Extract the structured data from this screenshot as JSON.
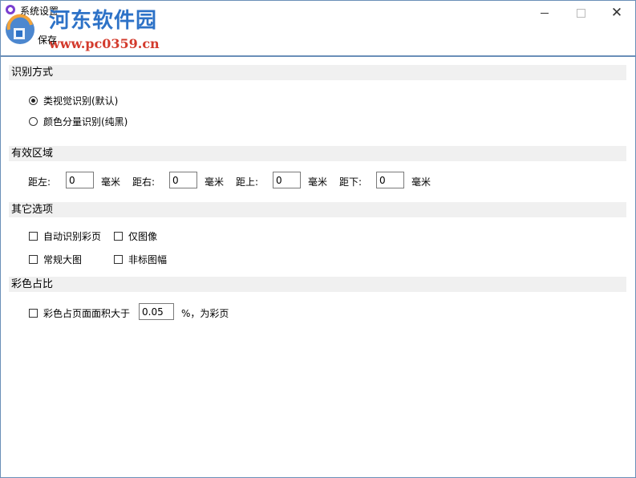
{
  "window": {
    "title": "系统设置",
    "controls": {
      "minimize": "minimize-icon",
      "maximize": "maximize-icon",
      "close": "close-icon"
    }
  },
  "watermark": {
    "site_name": "河东软件园",
    "url": "www.pc0359.cn"
  },
  "toolbar": {
    "save_label": "保存"
  },
  "recognition": {
    "header": "识别方式",
    "options": [
      {
        "label": "类视觉识别(默认)",
        "selected": true
      },
      {
        "label": "颜色分量识别(纯黑)",
        "selected": false
      }
    ]
  },
  "effective_area": {
    "header": "有效区域",
    "fields": [
      {
        "label": "距左:",
        "value": "0",
        "unit": "毫米"
      },
      {
        "label": "距右:",
        "value": "0",
        "unit": "毫米"
      },
      {
        "label": "距上:",
        "value": "0",
        "unit": "毫米"
      },
      {
        "label": "距下:",
        "value": "0",
        "unit": "毫米"
      }
    ]
  },
  "other_options": {
    "header": "其它选项",
    "checkboxes": [
      {
        "label": "自动识别彩页",
        "checked": false
      },
      {
        "label": "仅图像",
        "checked": false
      },
      {
        "label": "常规大图",
        "checked": false
      },
      {
        "label": "非标图幅",
        "checked": false
      }
    ]
  },
  "color_ratio": {
    "header": "彩色占比",
    "checkbox_label": "彩色占页面面积大于",
    "checked": false,
    "value": "0.05",
    "suffix": "%，为彩页"
  },
  "colors": {
    "window_border": "#6a8fb8",
    "section_bg": "#f0f0f0",
    "watermark_blue": "#2d72c7",
    "watermark_red": "#d33a2c"
  }
}
